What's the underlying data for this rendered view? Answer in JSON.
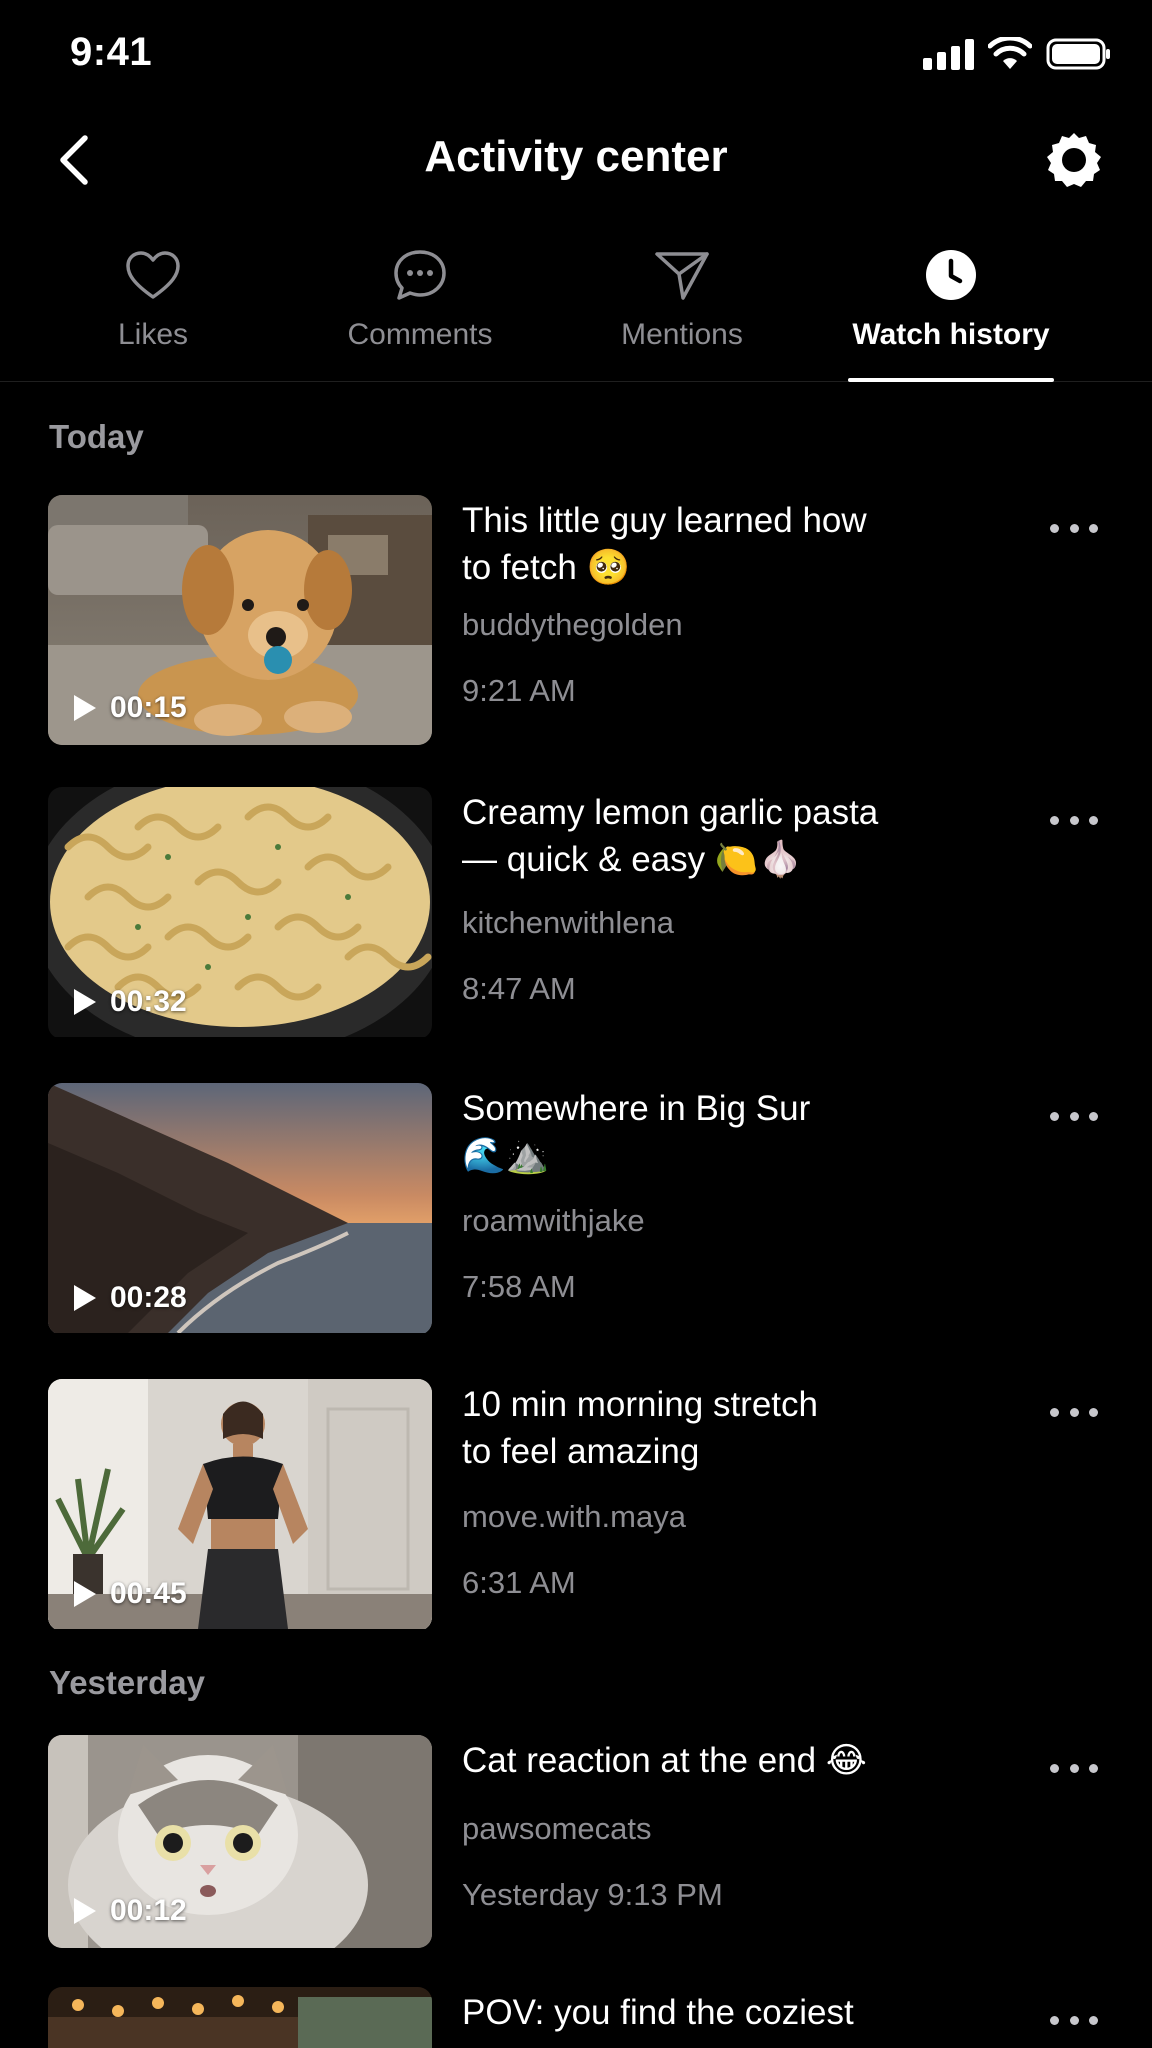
{
  "status_bar": {
    "time": "9:41"
  },
  "header": {
    "title": "Activity center"
  },
  "tabs": [
    {
      "label": "Likes",
      "icon": "heart-icon",
      "active": false
    },
    {
      "label": "Comments",
      "icon": "comment-bubble-icon",
      "active": false
    },
    {
      "label": "Mentions",
      "icon": "send-icon",
      "active": false
    },
    {
      "label": "Watch history",
      "icon": "clock-icon",
      "active": true
    }
  ],
  "sections": [
    {
      "label": "Today"
    },
    {
      "label": "Yesterday"
    }
  ],
  "items": [
    {
      "title_line1": "This little guy learned how",
      "title_line2": "to fetch 🥺",
      "username": "buddythegolden",
      "time": "9:21 AM",
      "duration": "00:15",
      "thumb": "golden retriever puppy with blue ball"
    },
    {
      "title_line1": "Creamy lemon garlic pasta",
      "title_line2": "— quick & easy 🍋🧄",
      "username": "kitchenwithlena",
      "time": "8:47 AM",
      "duration": "00:32",
      "thumb": "lemon garlic fusilli pasta in pan"
    },
    {
      "title_line1": "Somewhere in Big Sur",
      "title_line2": "🌊⛰️",
      "username": "roamwithjake",
      "time": "7:58 AM",
      "duration": "00:28",
      "thumb": "Big Sur coastline at sunset"
    },
    {
      "title_line1": "10 min morning stretch",
      "title_line2": "to feel amazing",
      "username": "move.with.maya",
      "time": "6:31 AM",
      "duration": "00:45",
      "thumb": "woman stretching in bright room"
    },
    {
      "title_line1": "Cat reaction at the end 😂",
      "title_line2": "",
      "username": "pawsomecats",
      "time": "Yesterday 9:13 PM",
      "duration": "00:12",
      "thumb": "surprised fluffy cat"
    },
    {
      "title_line1": "POV: you find the coziest",
      "title_line2": "",
      "username": "",
      "time": "",
      "duration": "",
      "thumb": "cozy cafe interior"
    }
  ],
  "colors": {
    "background": "#000000",
    "secondary_text": "#8e8e93",
    "active_tab": "#ffffff"
  }
}
